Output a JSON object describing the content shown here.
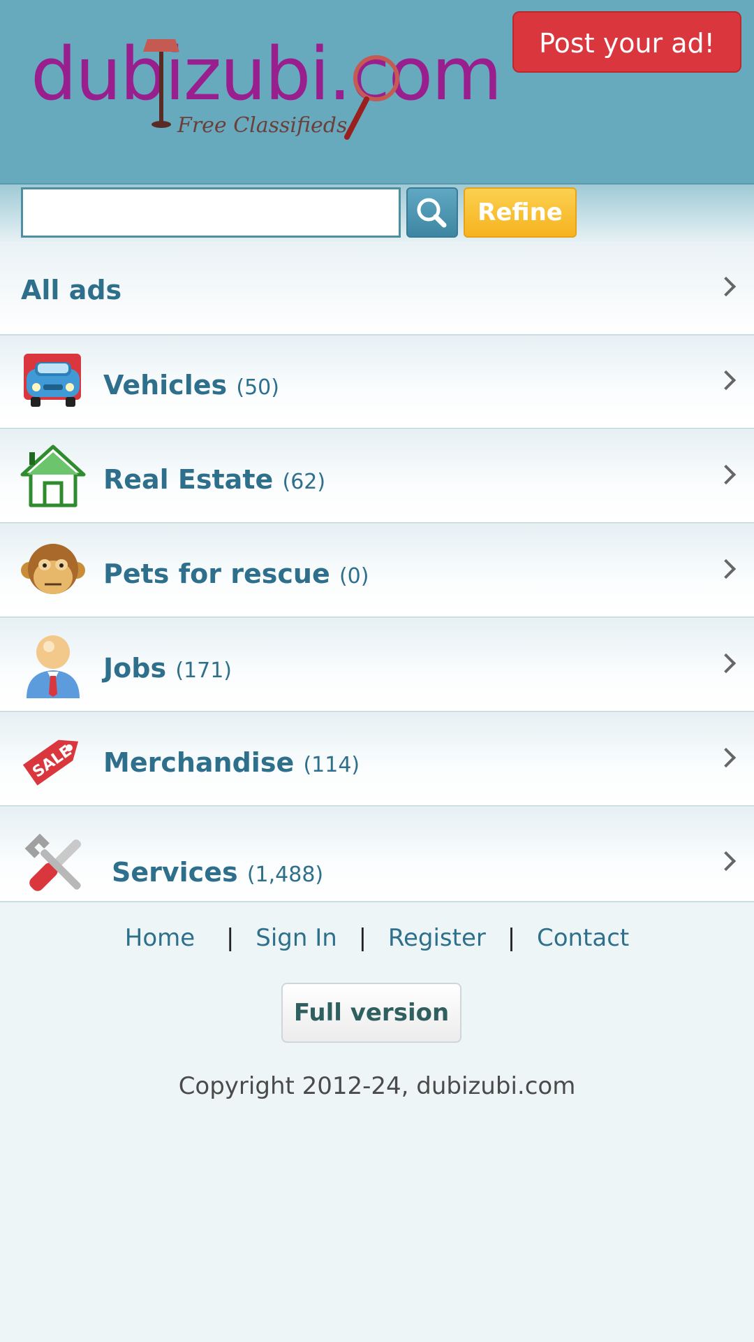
{
  "header": {
    "logo_text": "dubizubi.com",
    "logo_tagline": "Free Classifieds",
    "post_ad_label": "Post your ad!"
  },
  "search": {
    "value": "",
    "placeholder": "",
    "search_icon": "search-icon",
    "refine_label": "Refine"
  },
  "categories": [
    {
      "label": "All ads",
      "count": "",
      "icon": null
    },
    {
      "label": "Vehicles",
      "count": "(50)",
      "icon": "car-icon"
    },
    {
      "label": "Real Estate",
      "count": "(62)",
      "icon": "house-icon"
    },
    {
      "label": "Pets for rescue",
      "count": "(0)",
      "icon": "monkey-icon"
    },
    {
      "label": "Jobs",
      "count": "(171)",
      "icon": "person-icon"
    },
    {
      "label": "Merchandise",
      "count": "(114)",
      "icon": "sale-tag-icon"
    },
    {
      "label": "Services",
      "count": "(1,488)",
      "icon": "tools-icon"
    }
  ],
  "footer": {
    "links": [
      "Home",
      "Sign In",
      "Register",
      "Contact"
    ],
    "full_version_label": "Full version",
    "copyright": "Copyright 2012-24, dubizubi.com"
  },
  "colors": {
    "header_bg": "#67a9bd",
    "accent_text": "#2e6f8c",
    "post_button": "#d9373d",
    "refine_button": "#f7b31f",
    "logo": "#9a1f8e"
  }
}
